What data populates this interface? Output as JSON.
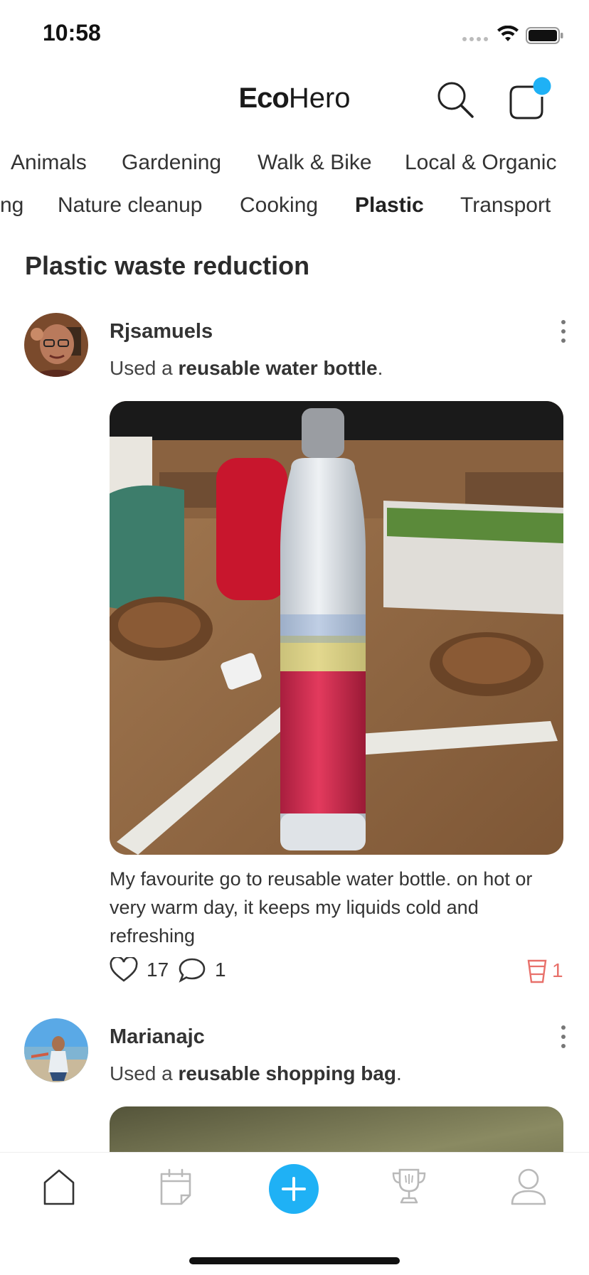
{
  "status_bar": {
    "time": "10:58"
  },
  "header": {
    "brand_bold": "Eco",
    "brand_light": "Hero"
  },
  "categories": {
    "row1": [
      "Animals",
      "Gardening",
      "Walk & Bike",
      "Local & Organic"
    ],
    "row2": [
      "ng",
      "Nature cleanup",
      "Cooking",
      "Plastic",
      "Transport"
    ],
    "active": "Plastic"
  },
  "section": {
    "title": "Plastic waste reduction"
  },
  "posts": [
    {
      "username": "Rjsamuels",
      "activity_prefix": "Used a ",
      "activity_item": "reusable water bottle",
      "activity_suffix": ".",
      "caption": "My favourite go to reusable water bottle. on hot or very warm day, it keeps my liquids cold and refreshing",
      "likes": "17",
      "comments": "1",
      "plastic_saved": "1"
    },
    {
      "username": "Marianajc",
      "activity_prefix": "Used a ",
      "activity_item": "reusable shopping bag",
      "activity_suffix": "."
    }
  ],
  "colors": {
    "accent": "#1FB1F5",
    "plastic": "#E8706A",
    "icon_gray": "#B9B9B9"
  },
  "icons": {
    "search": "search-icon",
    "notifications": "notification-icon",
    "more": "more-vertical-icon",
    "like": "heart-icon",
    "comment": "comment-icon",
    "plastic": "cup-icon",
    "nav": [
      "home-icon",
      "calendar-icon",
      "plus-icon",
      "trophy-icon",
      "profile-icon"
    ]
  }
}
